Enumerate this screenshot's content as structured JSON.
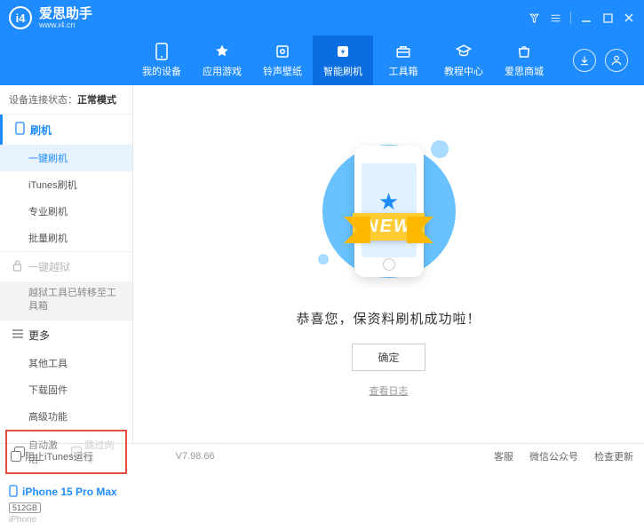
{
  "titlebar": {
    "app_name": "爱思助手",
    "url": "www.i4.cn"
  },
  "nav": {
    "items": [
      {
        "label": "我的设备"
      },
      {
        "label": "应用游戏"
      },
      {
        "label": "铃声壁纸"
      },
      {
        "label": "智能刷机"
      },
      {
        "label": "工具箱"
      },
      {
        "label": "教程中心"
      },
      {
        "label": "爱思商城"
      }
    ]
  },
  "sidebar": {
    "conn_prefix": "设备连接状态：",
    "conn_status": "正常模式",
    "flash": {
      "head": "刷机",
      "items": [
        "一键刷机",
        "iTunes刷机",
        "专业刷机",
        "批量刷机"
      ]
    },
    "jailbreak": {
      "head": "一键越狱",
      "note": "越狱工具已转移至工具箱"
    },
    "more": {
      "head": "更多",
      "items": [
        "其他工具",
        "下载固件",
        "高级功能"
      ]
    },
    "auto_activate": "自动激活",
    "skip_wizard": "跳过向导",
    "device_name": "iPhone 15 Pro Max",
    "device_storage": "512GB",
    "device_type": "iPhone"
  },
  "main": {
    "ribbon": "NEW",
    "success": "恭喜您，保资料刷机成功啦！",
    "ok": "确定",
    "view_log": "查看日志"
  },
  "footer": {
    "block_itunes": "阻止iTunes运行",
    "version": "V7.98.66",
    "links": [
      "客服",
      "微信公众号",
      "检查更新"
    ]
  }
}
